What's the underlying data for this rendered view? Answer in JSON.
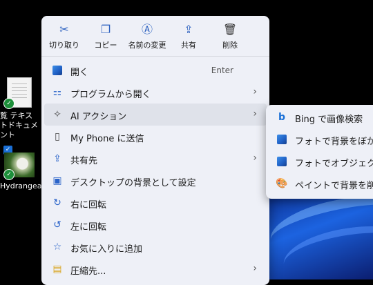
{
  "desktop": {
    "file1_label": "覧 テキストドキュメント",
    "file2_label": "Hydrangeas"
  },
  "toolbar": [
    {
      "label": "切り取り",
      "icon": "scissors-icon"
    },
    {
      "label": "コピー",
      "icon": "copy-icon"
    },
    {
      "label": "名前の変更",
      "icon": "rename-icon"
    },
    {
      "label": "共有",
      "icon": "share-icon"
    },
    {
      "label": "削除",
      "icon": "trash-icon"
    }
  ],
  "menu": {
    "items": [
      {
        "label": "開く",
        "shortcut": "Enter",
        "icon": "image-icon"
      },
      {
        "label": "プログラムから開く",
        "icon": "apps-icon",
        "submenu": true
      },
      {
        "label": "AI アクション",
        "icon": "ai-sparkle-icon",
        "submenu": true
      },
      {
        "label": "My Phone に送信",
        "icon": "phone-icon"
      },
      {
        "label": "共有先",
        "icon": "share-icon",
        "submenu": true
      },
      {
        "label": "デスクトップの背景として設定",
        "icon": "wallpaper-icon"
      },
      {
        "label": "右に回転",
        "icon": "rotate-right-icon"
      },
      {
        "label": "左に回転",
        "icon": "rotate-left-icon"
      },
      {
        "label": "お気に入りに追加",
        "icon": "star-icon"
      },
      {
        "label": "圧縮先...",
        "icon": "zip-folder-icon",
        "submenu": true
      }
    ]
  },
  "submenu": {
    "items": [
      {
        "label": "Bing で画像検索",
        "icon": "bing-icon"
      },
      {
        "label": "フォトで背景をぼかす",
        "icon": "photos-icon"
      },
      {
        "label": "フォトでオブジェクトを消",
        "icon": "photos-icon"
      },
      {
        "label": "ペイントで背景を削除",
        "icon": "paint-icon"
      }
    ]
  },
  "colors": {
    "menu_bg": "#eef0f7",
    "hover_bg": "#dfe2ea",
    "accent": "#2a63c9"
  }
}
